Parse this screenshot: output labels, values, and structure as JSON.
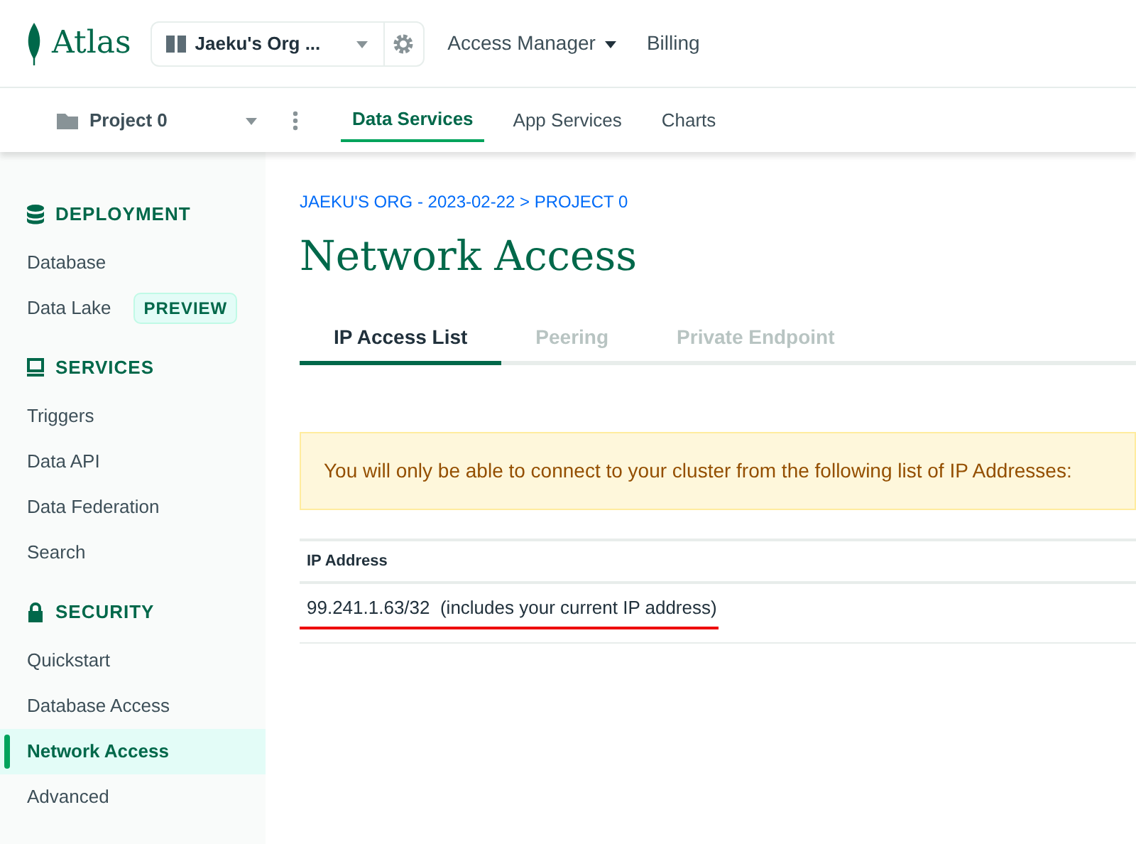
{
  "brand": "Atlas",
  "org_picker": {
    "label": "Jaeku's Org ..."
  },
  "top_nav": [
    {
      "label": "Access Manager",
      "dropdown": true
    },
    {
      "label": "Billing",
      "dropdown": false
    }
  ],
  "project_picker": {
    "label": "Project 0"
  },
  "service_tabs": [
    {
      "label": "Data Services",
      "selected": true
    },
    {
      "label": "App Services",
      "selected": false
    },
    {
      "label": "Charts",
      "selected": false
    }
  ],
  "sidebar": [
    {
      "title": "DEPLOYMENT",
      "kind": "database",
      "items": [
        {
          "label": "Database",
          "selected": false
        },
        {
          "label": "Data Lake",
          "selected": false,
          "badge": "PREVIEW"
        }
      ]
    },
    {
      "title": "SERVICES",
      "kind": "screen",
      "items": [
        {
          "label": "Triggers",
          "selected": false
        },
        {
          "label": "Data API",
          "selected": false
        },
        {
          "label": "Data Federation",
          "selected": false
        },
        {
          "label": "Search",
          "selected": false
        }
      ]
    },
    {
      "title": "SECURITY",
      "kind": "lock",
      "items": [
        {
          "label": "Quickstart",
          "selected": false
        },
        {
          "label": "Database Access",
          "selected": false
        },
        {
          "label": "Network Access",
          "selected": true
        },
        {
          "label": "Advanced",
          "selected": false
        }
      ]
    }
  ],
  "breadcrumb": "JAEKU'S ORG - 2023-02-22 > PROJECT 0",
  "page_title": "Network Access",
  "tabs": [
    {
      "label": "IP Access List",
      "selected": true
    },
    {
      "label": "Peering",
      "selected": false
    },
    {
      "label": "Private Endpoint",
      "selected": false
    }
  ],
  "notice": "You will only be able to connect to your cluster from the following list of IP Addresses:",
  "table": {
    "columns": [
      "IP Address"
    ],
    "rows": [
      {
        "address": "99.241.1.63/32",
        "note": "(includes your current IP address)",
        "underlined": true
      }
    ]
  }
}
